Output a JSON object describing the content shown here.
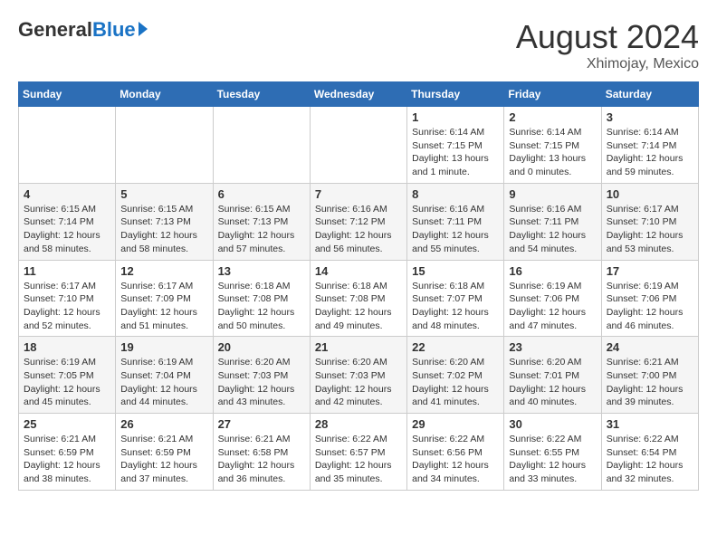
{
  "header": {
    "logo_general": "General",
    "logo_blue": "Blue",
    "month_year": "August 2024",
    "location": "Xhimojay, Mexico"
  },
  "days_of_week": [
    "Sunday",
    "Monday",
    "Tuesday",
    "Wednesday",
    "Thursday",
    "Friday",
    "Saturday"
  ],
  "weeks": [
    [
      {
        "day": "",
        "info": ""
      },
      {
        "day": "",
        "info": ""
      },
      {
        "day": "",
        "info": ""
      },
      {
        "day": "",
        "info": ""
      },
      {
        "day": "1",
        "info": "Sunrise: 6:14 AM\nSunset: 7:15 PM\nDaylight: 13 hours\nand 1 minute."
      },
      {
        "day": "2",
        "info": "Sunrise: 6:14 AM\nSunset: 7:15 PM\nDaylight: 13 hours\nand 0 minutes."
      },
      {
        "day": "3",
        "info": "Sunrise: 6:14 AM\nSunset: 7:14 PM\nDaylight: 12 hours\nand 59 minutes."
      }
    ],
    [
      {
        "day": "4",
        "info": "Sunrise: 6:15 AM\nSunset: 7:14 PM\nDaylight: 12 hours\nand 58 minutes."
      },
      {
        "day": "5",
        "info": "Sunrise: 6:15 AM\nSunset: 7:13 PM\nDaylight: 12 hours\nand 58 minutes."
      },
      {
        "day": "6",
        "info": "Sunrise: 6:15 AM\nSunset: 7:13 PM\nDaylight: 12 hours\nand 57 minutes."
      },
      {
        "day": "7",
        "info": "Sunrise: 6:16 AM\nSunset: 7:12 PM\nDaylight: 12 hours\nand 56 minutes."
      },
      {
        "day": "8",
        "info": "Sunrise: 6:16 AM\nSunset: 7:11 PM\nDaylight: 12 hours\nand 55 minutes."
      },
      {
        "day": "9",
        "info": "Sunrise: 6:16 AM\nSunset: 7:11 PM\nDaylight: 12 hours\nand 54 minutes."
      },
      {
        "day": "10",
        "info": "Sunrise: 6:17 AM\nSunset: 7:10 PM\nDaylight: 12 hours\nand 53 minutes."
      }
    ],
    [
      {
        "day": "11",
        "info": "Sunrise: 6:17 AM\nSunset: 7:10 PM\nDaylight: 12 hours\nand 52 minutes."
      },
      {
        "day": "12",
        "info": "Sunrise: 6:17 AM\nSunset: 7:09 PM\nDaylight: 12 hours\nand 51 minutes."
      },
      {
        "day": "13",
        "info": "Sunrise: 6:18 AM\nSunset: 7:08 PM\nDaylight: 12 hours\nand 50 minutes."
      },
      {
        "day": "14",
        "info": "Sunrise: 6:18 AM\nSunset: 7:08 PM\nDaylight: 12 hours\nand 49 minutes."
      },
      {
        "day": "15",
        "info": "Sunrise: 6:18 AM\nSunset: 7:07 PM\nDaylight: 12 hours\nand 48 minutes."
      },
      {
        "day": "16",
        "info": "Sunrise: 6:19 AM\nSunset: 7:06 PM\nDaylight: 12 hours\nand 47 minutes."
      },
      {
        "day": "17",
        "info": "Sunrise: 6:19 AM\nSunset: 7:06 PM\nDaylight: 12 hours\nand 46 minutes."
      }
    ],
    [
      {
        "day": "18",
        "info": "Sunrise: 6:19 AM\nSunset: 7:05 PM\nDaylight: 12 hours\nand 45 minutes."
      },
      {
        "day": "19",
        "info": "Sunrise: 6:19 AM\nSunset: 7:04 PM\nDaylight: 12 hours\nand 44 minutes."
      },
      {
        "day": "20",
        "info": "Sunrise: 6:20 AM\nSunset: 7:03 PM\nDaylight: 12 hours\nand 43 minutes."
      },
      {
        "day": "21",
        "info": "Sunrise: 6:20 AM\nSunset: 7:03 PM\nDaylight: 12 hours\nand 42 minutes."
      },
      {
        "day": "22",
        "info": "Sunrise: 6:20 AM\nSunset: 7:02 PM\nDaylight: 12 hours\nand 41 minutes."
      },
      {
        "day": "23",
        "info": "Sunrise: 6:20 AM\nSunset: 7:01 PM\nDaylight: 12 hours\nand 40 minutes."
      },
      {
        "day": "24",
        "info": "Sunrise: 6:21 AM\nSunset: 7:00 PM\nDaylight: 12 hours\nand 39 minutes."
      }
    ],
    [
      {
        "day": "25",
        "info": "Sunrise: 6:21 AM\nSunset: 6:59 PM\nDaylight: 12 hours\nand 38 minutes."
      },
      {
        "day": "26",
        "info": "Sunrise: 6:21 AM\nSunset: 6:59 PM\nDaylight: 12 hours\nand 37 minutes."
      },
      {
        "day": "27",
        "info": "Sunrise: 6:21 AM\nSunset: 6:58 PM\nDaylight: 12 hours\nand 36 minutes."
      },
      {
        "day": "28",
        "info": "Sunrise: 6:22 AM\nSunset: 6:57 PM\nDaylight: 12 hours\nand 35 minutes."
      },
      {
        "day": "29",
        "info": "Sunrise: 6:22 AM\nSunset: 6:56 PM\nDaylight: 12 hours\nand 34 minutes."
      },
      {
        "day": "30",
        "info": "Sunrise: 6:22 AM\nSunset: 6:55 PM\nDaylight: 12 hours\nand 33 minutes."
      },
      {
        "day": "31",
        "info": "Sunrise: 6:22 AM\nSunset: 6:54 PM\nDaylight: 12 hours\nand 32 minutes."
      }
    ]
  ]
}
